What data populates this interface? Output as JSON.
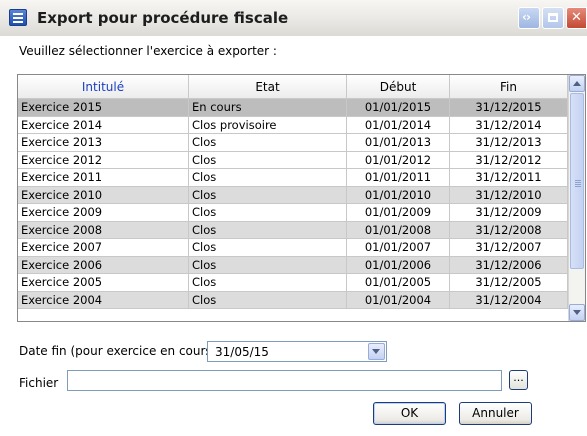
{
  "window": {
    "title": "Export pour procédure fiscale"
  },
  "prompt": "Veuillez sélectionner l'exercice à exporter :",
  "table": {
    "columns": [
      "Intitulé",
      "Etat",
      "Début",
      "Fin"
    ],
    "rows": [
      [
        "Exercice 2015",
        "En cours",
        "01/01/2015",
        "31/12/2015"
      ],
      [
        "Exercice 2014",
        "Clos provisoire",
        "01/01/2014",
        "31/12/2014"
      ],
      [
        "Exercice 2013",
        "Clos",
        "01/01/2013",
        "31/12/2013"
      ],
      [
        "Exercice 2012",
        "Clos",
        "01/01/2012",
        "31/12/2012"
      ],
      [
        "Exercice 2011",
        "Clos",
        "01/01/2011",
        "31/12/2011"
      ],
      [
        "Exercice 2010",
        "Clos",
        "01/01/2010",
        "31/12/2010"
      ],
      [
        "Exercice 2009",
        "Clos",
        "01/01/2009",
        "31/12/2009"
      ],
      [
        "Exercice 2008",
        "Clos",
        "01/01/2008",
        "31/12/2008"
      ],
      [
        "Exercice 2007",
        "Clos",
        "01/01/2007",
        "31/12/2007"
      ],
      [
        "Exercice 2006",
        "Clos",
        "01/01/2006",
        "31/12/2006"
      ],
      [
        "Exercice 2005",
        "Clos",
        "01/01/2005",
        "31/12/2005"
      ],
      [
        "Exercice 2004",
        "Clos",
        "01/01/2004",
        "31/12/2004"
      ]
    ],
    "selected_row": 0
  },
  "date_fin": {
    "label": "Date fin (pour exercice en cours)",
    "value": "31/05/15"
  },
  "fichier": {
    "label": "Fichier",
    "value": "",
    "browse_label": "..."
  },
  "buttons": {
    "ok": "OK",
    "cancel": "Annuler"
  },
  "icons": [
    "app-icon",
    "back-forward-icon",
    "maximize-icon",
    "close-icon",
    "scroll-up-icon",
    "scroll-down-icon",
    "dropdown-arrow-icon"
  ]
}
